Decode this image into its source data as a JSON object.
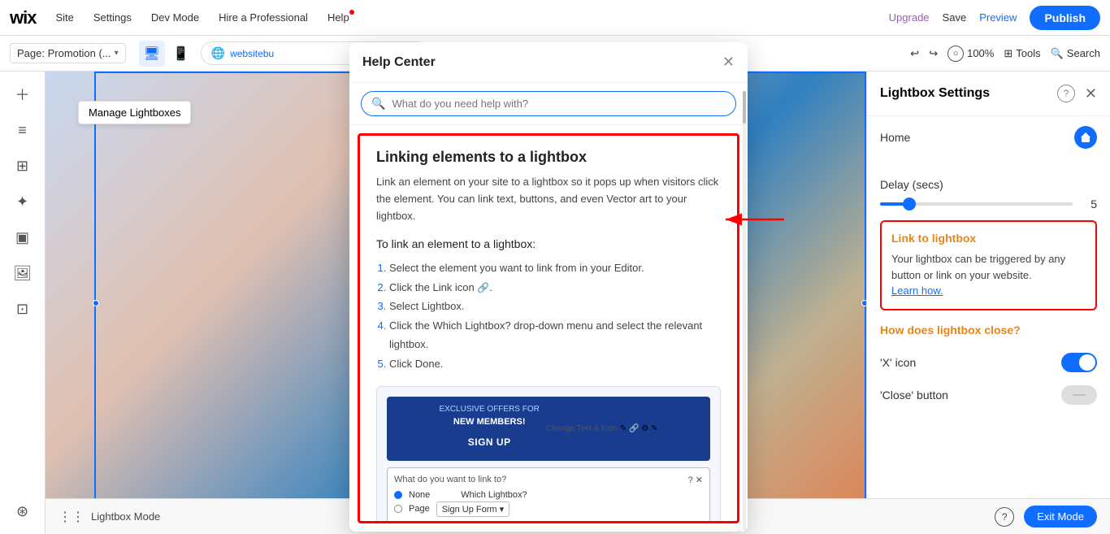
{
  "topnav": {
    "logo": "W",
    "items": [
      "Site",
      "Settings",
      "Dev Mode",
      "Hire a Professional",
      "Help"
    ],
    "upgrade": "Upgrade",
    "save": "Save",
    "preview": "Preview",
    "publish": "Publish"
  },
  "secondbar": {
    "page_label": "Page: Promotion (...",
    "url": "websitebu",
    "zoom": "100%",
    "tools": "Tools",
    "search": "Search"
  },
  "sidebar_icons": [
    "＋",
    "≡",
    "⊞",
    "✦",
    "▣",
    "🖼",
    "⊡"
  ],
  "canvas": {
    "manage_lightboxes": "Manage Lightboxes"
  },
  "lightbox_settings": {
    "title": "Lightbox Settings",
    "home_label": "Home",
    "delay_label": "Delay (secs)",
    "delay_value": "5",
    "link_lightbox_title": "Link to lightbox",
    "link_lightbox_desc": "Your lightbox can be triggered by any button or link on your website.",
    "learn_how": "Learn how.",
    "how_close_title": "How does lightbox close?",
    "x_icon_label": "'X' icon",
    "close_btn_label": "'Close' button"
  },
  "bottom_bar": {
    "lightbox_mode": "Lightbox Mode",
    "exit_mode": "Exit Mode"
  },
  "help_center": {
    "title": "Help Center",
    "search_placeholder": "What do you need help with?",
    "article": {
      "title": "Linking elements to a lightbox",
      "intro": "Link an element on your site to a lightbox so it pops up when visitors click the element. You can link text, buttons, and even Vector art to your lightbox.",
      "subtitle": "To link an element to a lightbox:",
      "steps": [
        "Select the element you want to link from in your Editor.",
        "Click the Link icon 🔗.",
        "Select Lightbox.",
        "Click the Which Lightbox? drop-down menu and select the relevant lightbox.",
        "Click Done."
      ]
    }
  }
}
